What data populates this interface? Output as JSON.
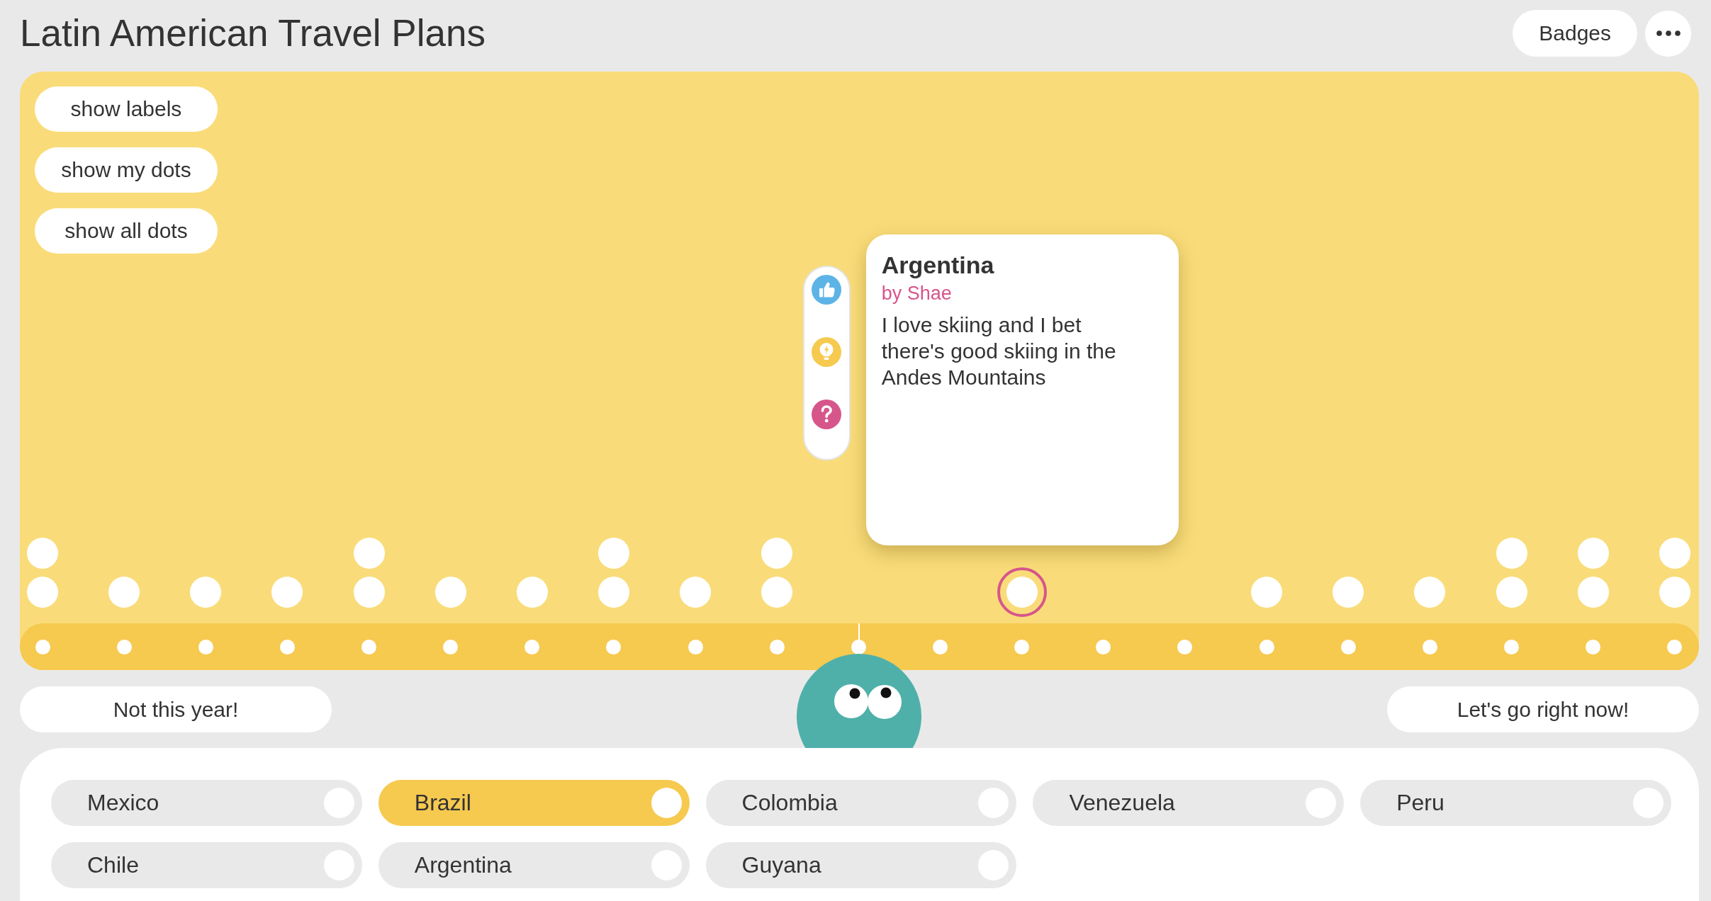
{
  "header": {
    "title": "Latin American Travel Plans",
    "badges_button": "Badges"
  },
  "board": {
    "view_buttons": [
      "show labels",
      "show my dots",
      "show all dots"
    ],
    "card": {
      "title": "Argentina",
      "author": "by Shae",
      "text": "I love skiing and I bet there's good skiing in the Andes Mountains"
    },
    "reactions": [
      {
        "kind": "like"
      },
      {
        "kind": "idea"
      },
      {
        "kind": "question"
      }
    ],
    "scale": {
      "level": 0.5,
      "stops": [
        {
          "kind": "responses",
          "dots": [
            {
              "selected": false
            },
            {
              "selected": false
            }
          ]
        },
        {
          "kind": "responses",
          "dots": [
            {
              "selected": false
            }
          ]
        },
        {
          "kind": "responses",
          "dots": [
            {
              "selected": false
            }
          ]
        },
        {
          "kind": "responses",
          "dots": [
            {
              "selected": false
            }
          ]
        },
        {
          "kind": "responses",
          "dots": [
            {
              "selected": false
            },
            {
              "selected": false
            }
          ]
        },
        {
          "kind": "responses",
          "dots": [
            {
              "selected": false
            }
          ]
        },
        {
          "kind": "responses",
          "dots": [
            {
              "selected": false
            }
          ]
        },
        {
          "kind": "responses",
          "dots": [
            {
              "selected": false
            },
            {
              "selected": false
            }
          ]
        },
        {
          "kind": "responses",
          "dots": [
            {
              "selected": false
            }
          ]
        },
        {
          "kind": "responses",
          "dots": [
            {
              "selected": false
            },
            {
              "selected": false
            }
          ]
        },
        {
          "kind": "empty"
        },
        {
          "kind": "empty"
        },
        {
          "kind": "responses",
          "dots": [
            {
              "selected": true
            }
          ]
        },
        {
          "kind": "empty"
        },
        {
          "kind": "empty"
        },
        {
          "kind": "responses",
          "dots": [
            {
              "selected": false
            }
          ]
        },
        {
          "kind": "responses",
          "dots": [
            {
              "selected": false
            }
          ]
        },
        {
          "kind": "responses",
          "dots": [
            {
              "selected": false
            }
          ]
        },
        {
          "kind": "responses",
          "dots": [
            {
              "selected": false
            },
            {
              "selected": false
            }
          ]
        },
        {
          "kind": "responses",
          "dots": [
            {
              "selected": false
            },
            {
              "selected": false
            }
          ]
        },
        {
          "kind": "responses",
          "dots": [
            {
              "selected": false
            },
            {
              "selected": false
            }
          ]
        }
      ]
    }
  },
  "scale_ends": [
    "Not this year!",
    "Let's go right now!"
  ],
  "countries": [
    {
      "label": "Mexico",
      "selected": false
    },
    {
      "label": "Brazil",
      "selected": true
    },
    {
      "label": "Colombia",
      "selected": false
    },
    {
      "label": "Venezuela",
      "selected": false
    },
    {
      "label": "Peru",
      "selected": false
    },
    {
      "label": "Chile",
      "selected": false
    },
    {
      "label": "Argentina",
      "selected": false
    },
    {
      "label": "Guyana",
      "selected": false
    }
  ]
}
